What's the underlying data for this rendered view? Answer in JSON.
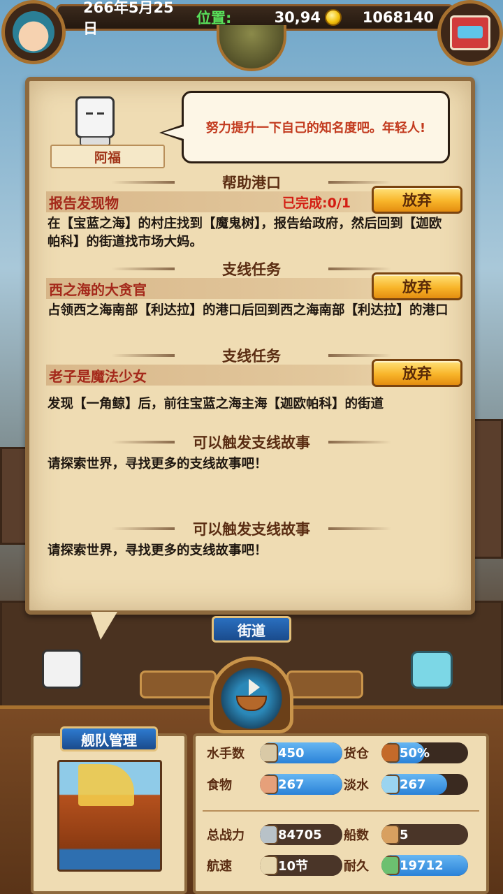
{
  "topbar": {
    "date": "266年5月25日",
    "pos_label": "位置:",
    "position": "30,94",
    "gold": "1068140"
  },
  "npc": {
    "name": "阿福",
    "speech": "努力提升一下自己的知名度吧。年轻人!"
  },
  "quests": [
    {
      "section": "帮助港口",
      "title": "报告发现物",
      "status": "已完成:0/1",
      "button": "放弃",
      "description": "在【宝蓝之海】的村庄找到【魔鬼树】，报告给政府，然后回到【迦欧帕科】的街道找市场大妈。"
    },
    {
      "section": "支线任务",
      "title": "西之海的大贪官",
      "status": "",
      "button": "放弃",
      "description": "占领西之海南部【利达拉】的港口后回到西之海南部【利达拉】的港口"
    },
    {
      "section": "支线任务",
      "title": "老子是魔法少女",
      "status": "",
      "button": "放弃",
      "description": "发现【一角鲸】后，前往宝蓝之海主海【迦欧帕科】的街道"
    }
  ],
  "triggers": [
    {
      "section": "可以触发支线故事",
      "description": "请探索世界，寻找更多的支线故事吧！"
    },
    {
      "section": "可以触发支线故事",
      "description": "请探索世界，寻找更多的支线故事吧！"
    }
  ],
  "location_tab": "街道",
  "fleet": {
    "title": "舰队管理",
    "stats": {
      "sailors_label": "水手数",
      "sailors": "450",
      "cargo_label": "货仓",
      "cargo": "50%",
      "food_label": "食物",
      "food": "267",
      "water_label": "淡水",
      "water": "267",
      "power_label": "总战力",
      "power": "84705",
      "ships_label": "船数",
      "ships": "5",
      "speed_label": "航速",
      "speed": "10节",
      "durability_label": "耐久",
      "durability": "19712"
    }
  },
  "icons": {
    "avatar": "player-avatar-icon",
    "chest": "treasure-chest-icon",
    "coin": "gold-coin-icon",
    "sailor": "sailor-icon",
    "cargo": "cargo-crate-icon",
    "food": "meat-icon",
    "water": "water-bottle-icon",
    "power": "crossed-swords-icon",
    "ships": "ship-count-icon",
    "speed": "sail-speed-icon",
    "durability": "hull-durability-icon"
  },
  "colors": {
    "accent_blue": "#2a82d8",
    "quest_title": "#a4281a",
    "status_red": "#d31d12",
    "button_gold": "#f8b52a",
    "parchment": "#efdcb3"
  }
}
